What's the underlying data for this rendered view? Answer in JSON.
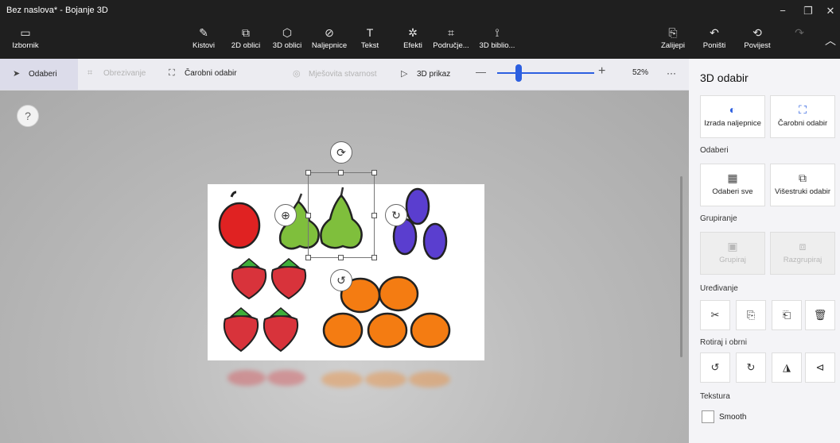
{
  "window": {
    "title": "Bez naslova* - Bojanje 3D",
    "controls": {
      "minimize": "−",
      "maximize": "❐",
      "close": "✕"
    }
  },
  "ribbon": {
    "menu": {
      "label": "Izbornik",
      "icon": "folder-icon",
      "glyph": "▭"
    },
    "tools": [
      {
        "label": "Kistovi",
        "icon": "brush-icon",
        "glyph": "✎"
      },
      {
        "label": "2D oblici",
        "icon": "shapes-2d-icon",
        "glyph": "⧉"
      },
      {
        "label": "3D oblici",
        "icon": "cube-icon",
        "glyph": "⬡"
      },
      {
        "label": "Naljepnice",
        "icon": "sticker-icon",
        "glyph": "⊘"
      },
      {
        "label": "Tekst",
        "icon": "text-icon",
        "glyph": "T"
      },
      {
        "label": "Efekti",
        "icon": "effects-icon",
        "glyph": "✲"
      },
      {
        "label": "Područje...",
        "icon": "canvas-icon",
        "glyph": "⌗"
      },
      {
        "label": "3D biblio...",
        "icon": "library-icon",
        "glyph": "⟟"
      }
    ],
    "right": [
      {
        "label": "Zalijepi",
        "icon": "paste-icon",
        "glyph": "⎘"
      },
      {
        "label": "Poništi",
        "icon": "undo-icon",
        "glyph": "↶"
      },
      {
        "label": "Povijest",
        "icon": "history-icon",
        "glyph": "⟲"
      },
      {
        "label": "",
        "icon": "redo-icon",
        "glyph": "↷"
      }
    ],
    "collapse_glyph": "︿"
  },
  "subtoolbar": {
    "select": "Odaberi",
    "crop": "Obrezivanje",
    "magic_select": "Čarobni odabir",
    "mixed_reality": "Mješovita stvarnost",
    "view_3d": "3D prikaz",
    "zoom_minus": "—",
    "zoom_plus": "+",
    "zoom_value": "52%",
    "zoom_percent": 52,
    "more": "···"
  },
  "canvas": {
    "help": "?"
  },
  "panel": {
    "title": "3D odabir",
    "top_cards": [
      {
        "label": "Izrada naljepnice",
        "icon": "make-sticker-icon",
        "glyph": "◐"
      },
      {
        "label": "Čarobni odabir",
        "icon": "magic-select-icon",
        "glyph": "⛶"
      }
    ],
    "select_section": "Odaberi",
    "select_cards": [
      {
        "label": "Odaberi sve",
        "icon": "select-all-icon",
        "glyph": "▦"
      },
      {
        "label": "Višestruki odabir",
        "icon": "multi-select-icon",
        "glyph": "⧉"
      }
    ],
    "group_section": "Grupiranje",
    "group_cards": [
      {
        "label": "Grupiraj",
        "icon": "group-icon",
        "glyph": "▣"
      },
      {
        "label": "Razgrupiraj",
        "icon": "ungroup-icon",
        "glyph": "⧈"
      }
    ],
    "edit_section": "Uređivanje",
    "edit_buttons": [
      {
        "icon": "cut-icon",
        "glyph": "✂"
      },
      {
        "icon": "copy-icon",
        "glyph": "⎘"
      },
      {
        "icon": "paste-icon",
        "glyph": "⎗"
      },
      {
        "icon": "delete-icon",
        "glyph": "🗑"
      }
    ],
    "rotate_section": "Rotiraj i obrni",
    "rotate_buttons": [
      {
        "icon": "rotate-left-icon",
        "glyph": "↺"
      },
      {
        "icon": "rotate-right-icon",
        "glyph": "↻"
      },
      {
        "icon": "flip-horizontal-icon",
        "glyph": "◮"
      },
      {
        "icon": "flip-vertical-icon",
        "glyph": "⊲"
      }
    ],
    "texture_section": "Tekstura",
    "smooth_label": "Smooth",
    "smooth_checked": false
  },
  "colors": {
    "accent": "#2c5fe0",
    "apple": "#e02222",
    "pear": "#7fbf3c",
    "plum": "#5a3ecf",
    "strawberry": "#d8333b",
    "strawberry_leaf": "#3fae3a",
    "orange": "#f47c12"
  }
}
